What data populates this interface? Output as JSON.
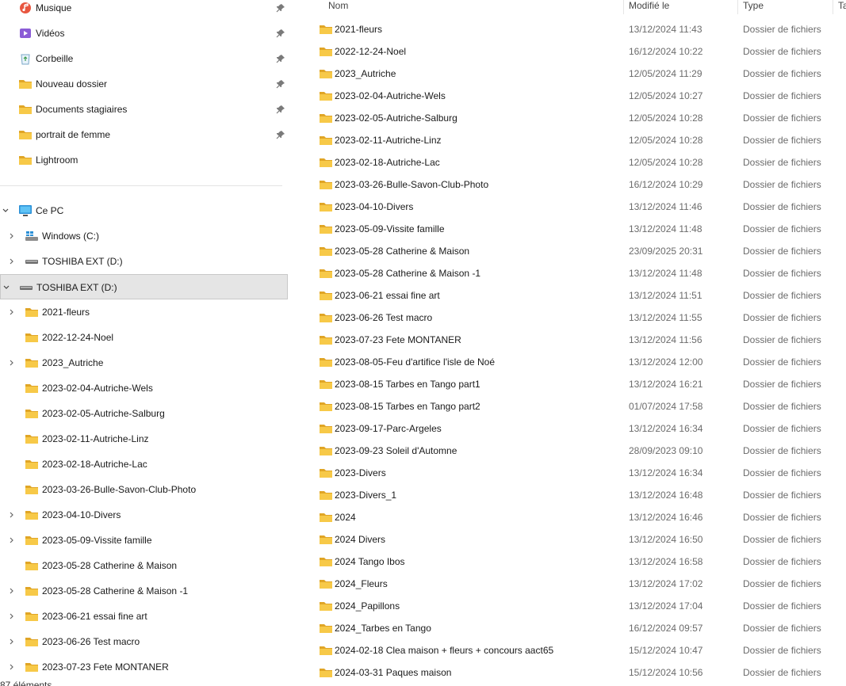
{
  "quick_access": [
    {
      "label": "Musique",
      "icon": "music-icon",
      "pinned": true
    },
    {
      "label": "Vidéos",
      "icon": "videos-icon",
      "pinned": true
    },
    {
      "label": "Corbeille",
      "icon": "recycle-bin-icon",
      "pinned": true
    },
    {
      "label": "Nouveau dossier",
      "icon": "folder-icon",
      "pinned": true
    },
    {
      "label": "Documents stagiaires",
      "icon": "folder-icon",
      "pinned": true
    },
    {
      "label": "portrait de femme",
      "icon": "folder-icon",
      "pinned": true
    },
    {
      "label": "Lightroom",
      "icon": "folder-icon",
      "pinned": false
    }
  ],
  "tree": [
    {
      "label": "Ce PC",
      "icon": "pc-icon",
      "chevron": "down",
      "level": 0
    },
    {
      "label": "Windows (C:)",
      "icon": "windows-drive-icon",
      "chevron": "right",
      "level": 1
    },
    {
      "label": "TOSHIBA EXT (D:)",
      "icon": "drive-icon",
      "chevron": "right",
      "level": 1
    },
    {
      "label": "TOSHIBA EXT (D:)",
      "icon": "drive-icon",
      "chevron": "down",
      "level": 0,
      "selected": true
    },
    {
      "label": "2021-fleurs",
      "icon": "folder-icon",
      "chevron": "right",
      "level": 1
    },
    {
      "label": "2022-12-24-Noel",
      "icon": "folder-icon",
      "chevron": "",
      "level": 1
    },
    {
      "label": "2023_Autriche",
      "icon": "folder-icon",
      "chevron": "right",
      "level": 1
    },
    {
      "label": "2023-02-04-Autriche-Wels",
      "icon": "folder-icon",
      "chevron": "",
      "level": 1
    },
    {
      "label": "2023-02-05-Autriche-Salburg",
      "icon": "folder-icon",
      "chevron": "",
      "level": 1
    },
    {
      "label": "2023-02-11-Autriche-Linz",
      "icon": "folder-icon",
      "chevron": "",
      "level": 1
    },
    {
      "label": "2023-02-18-Autriche-Lac",
      "icon": "folder-icon",
      "chevron": "",
      "level": 1
    },
    {
      "label": "2023-03-26-Bulle-Savon-Club-Photo",
      "icon": "folder-icon",
      "chevron": "",
      "level": 1
    },
    {
      "label": "2023-04-10-Divers",
      "icon": "folder-icon",
      "chevron": "right",
      "level": 1
    },
    {
      "label": "2023-05-09-Vissite famille",
      "icon": "folder-icon",
      "chevron": "right",
      "level": 1
    },
    {
      "label": "2023-05-28 Catherine & Maison",
      "icon": "folder-icon",
      "chevron": "",
      "level": 1
    },
    {
      "label": "2023-05-28 Catherine & Maison -1",
      "icon": "folder-icon",
      "chevron": "right",
      "level": 1
    },
    {
      "label": "2023-06-21 essai fine art",
      "icon": "folder-icon",
      "chevron": "right",
      "level": 1
    },
    {
      "label": "2023-06-26 Test macro",
      "icon": "folder-icon",
      "chevron": "right",
      "level": 1
    },
    {
      "label": "2023-07-23 Fete MONTANER",
      "icon": "folder-icon",
      "chevron": "right",
      "level": 1
    }
  ],
  "status_fragment": "87 éléments",
  "columns": {
    "name": "Nom",
    "modified": "Modifié le",
    "type": "Type",
    "size": "Ta"
  },
  "files": [
    {
      "name": "2021-fleurs",
      "modified": "13/12/2024 11:43",
      "type": "Dossier de fichiers"
    },
    {
      "name": "2022-12-24-Noel",
      "modified": "16/12/2024 10:22",
      "type": "Dossier de fichiers"
    },
    {
      "name": "2023_Autriche",
      "modified": "12/05/2024 11:29",
      "type": "Dossier de fichiers"
    },
    {
      "name": "2023-02-04-Autriche-Wels",
      "modified": "12/05/2024 10:27",
      "type": "Dossier de fichiers"
    },
    {
      "name": "2023-02-05-Autriche-Salburg",
      "modified": "12/05/2024 10:28",
      "type": "Dossier de fichiers"
    },
    {
      "name": "2023-02-11-Autriche-Linz",
      "modified": "12/05/2024 10:28",
      "type": "Dossier de fichiers"
    },
    {
      "name": "2023-02-18-Autriche-Lac",
      "modified": "12/05/2024 10:28",
      "type": "Dossier de fichiers"
    },
    {
      "name": "2023-03-26-Bulle-Savon-Club-Photo",
      "modified": "16/12/2024 10:29",
      "type": "Dossier de fichiers"
    },
    {
      "name": "2023-04-10-Divers",
      "modified": "13/12/2024 11:46",
      "type": "Dossier de fichiers"
    },
    {
      "name": "2023-05-09-Vissite famille",
      "modified": "13/12/2024 11:48",
      "type": "Dossier de fichiers"
    },
    {
      "name": "2023-05-28 Catherine & Maison",
      "modified": "23/09/2025 20:31",
      "type": "Dossier de fichiers"
    },
    {
      "name": "2023-05-28 Catherine & Maison -1",
      "modified": "13/12/2024 11:48",
      "type": "Dossier de fichiers"
    },
    {
      "name": "2023-06-21 essai fine art",
      "modified": "13/12/2024 11:51",
      "type": "Dossier de fichiers"
    },
    {
      "name": "2023-06-26 Test macro",
      "modified": "13/12/2024 11:55",
      "type": "Dossier de fichiers"
    },
    {
      "name": "2023-07-23 Fete MONTANER",
      "modified": "13/12/2024 11:56",
      "type": "Dossier de fichiers"
    },
    {
      "name": "2023-08-05-Feu d'artifice l'isle de Noé",
      "modified": "13/12/2024 12:00",
      "type": "Dossier de fichiers"
    },
    {
      "name": "2023-08-15 Tarbes en Tango part1",
      "modified": "13/12/2024 16:21",
      "type": "Dossier de fichiers"
    },
    {
      "name": "2023-08-15 Tarbes en Tango part2",
      "modified": "01/07/2024 17:58",
      "type": "Dossier de fichiers"
    },
    {
      "name": "2023-09-17-Parc-Argeles",
      "modified": "13/12/2024 16:34",
      "type": "Dossier de fichiers"
    },
    {
      "name": "2023-09-23 Soleil d'Automne",
      "modified": "28/09/2023 09:10",
      "type": "Dossier de fichiers"
    },
    {
      "name": "2023-Divers",
      "modified": "13/12/2024 16:34",
      "type": "Dossier de fichiers"
    },
    {
      "name": "2023-Divers_1",
      "modified": "13/12/2024 16:48",
      "type": "Dossier de fichiers"
    },
    {
      "name": "2024",
      "modified": "13/12/2024 16:46",
      "type": "Dossier de fichiers"
    },
    {
      "name": "2024 Divers",
      "modified": "13/12/2024 16:50",
      "type": "Dossier de fichiers"
    },
    {
      "name": "2024 Tango Ibos",
      "modified": "13/12/2024 16:58",
      "type": "Dossier de fichiers"
    },
    {
      "name": "2024_Fleurs",
      "modified": "13/12/2024 17:02",
      "type": "Dossier de fichiers"
    },
    {
      "name": "2024_Papillons",
      "modified": "13/12/2024 17:04",
      "type": "Dossier de fichiers"
    },
    {
      "name": "2024_Tarbes en Tango",
      "modified": "16/12/2024 09:57",
      "type": "Dossier de fichiers"
    },
    {
      "name": "2024-02-18 Clea maison + fleurs + concours aact65",
      "modified": "15/12/2024 10:47",
      "type": "Dossier de fichiers"
    },
    {
      "name": "2024-03-31 Paques maison",
      "modified": "15/12/2024 10:56",
      "type": "Dossier de fichiers"
    }
  ],
  "colors": {
    "folder": "#f7c948",
    "folder_dark": "#e0a526",
    "selection": "#e5e5e5",
    "pc": "#2a8fd6"
  }
}
